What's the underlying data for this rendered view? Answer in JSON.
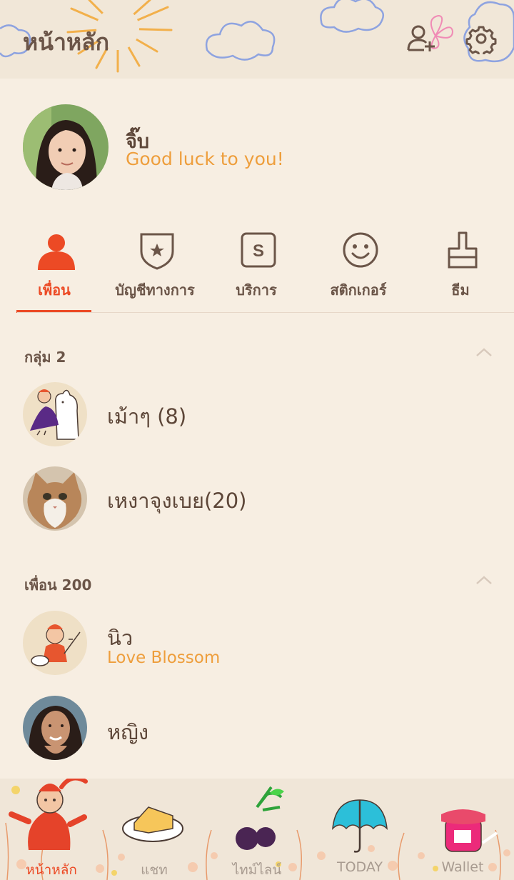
{
  "header": {
    "title": "หน้าหลัก"
  },
  "profile": {
    "name": "จิ๊บ",
    "status": "Good luck to you!"
  },
  "tabs": [
    {
      "label": "เพื่อน",
      "active": true
    },
    {
      "label": "บัญชีทางการ",
      "active": false
    },
    {
      "label": "บริการ",
      "active": false
    },
    {
      "label": "สติกเกอร์",
      "active": false
    },
    {
      "label": "ธีม",
      "active": false
    }
  ],
  "groups": {
    "header": "กลุ่ม 2",
    "items": [
      {
        "name": "เม้าๆ (8)"
      },
      {
        "name": "เหงาจุงเบย(20)"
      }
    ]
  },
  "friends": {
    "header": "เพื่อน 200",
    "items": [
      {
        "name": "นิว",
        "status": "Love Blossom"
      },
      {
        "name": "หญิง",
        "status": ""
      }
    ]
  },
  "bottom_nav": [
    {
      "label": "หน้าหลัก",
      "active": true
    },
    {
      "label": "แชท",
      "active": false
    },
    {
      "label": "ไทม์ไลน์",
      "active": false
    },
    {
      "label": "TODAY",
      "active": false
    },
    {
      "label": "Wallet",
      "active": false
    }
  ],
  "colors": {
    "accent": "#ec4a25",
    "status": "#ee9e3c",
    "text": "#6b5548",
    "background": "#f7eee2"
  },
  "icons": {
    "add_friend": "add-friend-icon",
    "settings": "gear-icon",
    "friends_tab": "person-icon",
    "official_tab": "shield-star-icon",
    "services_tab": "s-square-icon",
    "stickers_tab": "smiley-icon",
    "themes_tab": "brush-icon"
  }
}
